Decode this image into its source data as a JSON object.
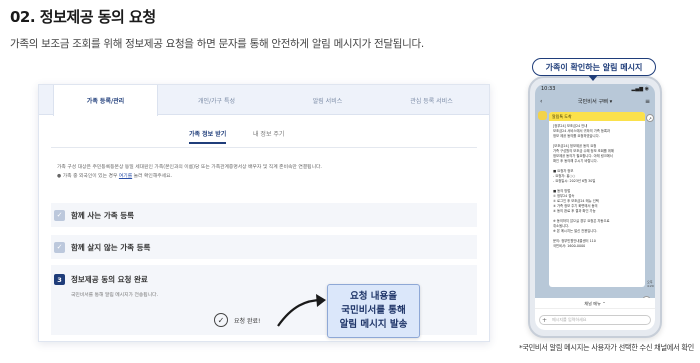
{
  "section": {
    "title": "02. 정보제공 동의 요청",
    "description": "가족의 보조금 조회를 위해 정보제공 요청을 하면 문자를 통해 안전하게 알림 메시지가 전달됩니다."
  },
  "tabs": [
    "가족 등록/관리",
    "개인/가구 특성",
    "알림 서비스",
    "관심 등록 서비스"
  ],
  "subtabs": [
    "가족 정보 받기",
    "내 정보 주기"
  ],
  "notice": {
    "line1": "가족 구성 대상은 주민등록등본상 동일 세대원인 가족(본인과의 이름)당 또는 가족관계증명서상 배우자 및 직계 존비속만 연결됩니다.",
    "line2_prefix": "가족 중 외국인이 있는 경우 ",
    "line2_link": "여기를",
    "line2_suffix": " 눌러 확인해주세요."
  },
  "steps": [
    {
      "label": "함께 사는 가족 등록"
    },
    {
      "label": "함께 살지 않는 가족 등록"
    }
  ],
  "step3": {
    "number": "3",
    "label": "정보제공 동의 요청 완료",
    "sub": "국민비서를 통해 알림 메시지가 전송됩니다.",
    "done_text": "요청 완료!"
  },
  "callout": {
    "line1": "요청 내용을",
    "line2": "국민비서를 통해",
    "line3": "알림 메시지 발송"
  },
  "phone": {
    "label": "가족이 확인하는 알림 메시지",
    "status_time": "10:33",
    "status_icons": "▂▄▆ ◉",
    "chat_title": "국민비서 구삐 ▾",
    "bubble_header": "알림톡 도착",
    "message": "[정부24] 보조금24 안내\n보조금24 서비스에서 귀하의 가족 등록과\n정보 제공 동의를 요청하였습니다.\n\n[보조금24] 정보제공 동의 요청\n가족 구성원의 보조금 수혜 정보 조회를 위해\n정보제공 동의가 필요합니다. 아래 링크에서\n확인 후 동의해 주시기 바랍니다.\n\n■ 요청자 정보\n- 요청자: 홍○○\n- 요청일시: 2023년 6월 30일\n\n■ 동의 방법\n① 정부24 접속\n② 로그인 후 보조금24 메뉴 선택\n③ 가족 정보 주기 화면에서 동의\n④ 동의 완료 후 결과 확인 가능\n\n※ 동의하지 않으실 경우 요청은 자동으로\n취소됩니다.\n※ 본 메시지는 발신 전용입니다.\n\n문의: 정부민원안내콜센터 110\n국민비서: 1600-0000",
    "time": "오후 4:20",
    "menu_label": "채널 메뉴 ⌃",
    "input_placeholder": "메시지를 입력하세요"
  },
  "footnote": "*국민비서 알림 메시지는 사용자가 선택한 수신 채널에서 확인"
}
